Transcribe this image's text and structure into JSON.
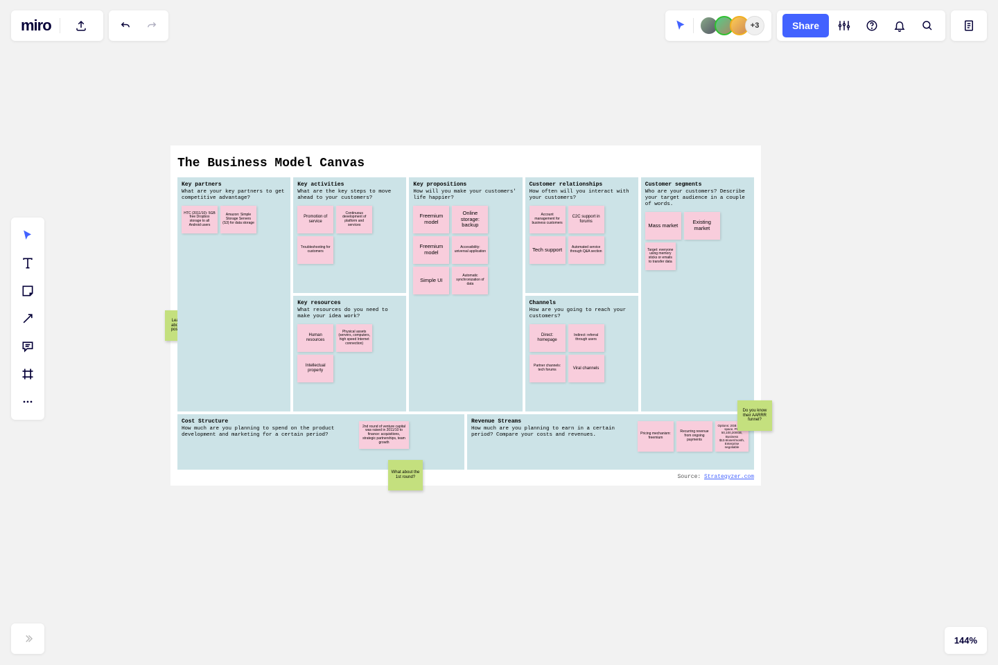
{
  "topbar": {
    "logo": "miro",
    "share": "Share",
    "avatar_more": "+3"
  },
  "zoom": "144%",
  "board": {
    "title": "The Business Model Canvas",
    "source_prefix": "Source: ",
    "source_link": "Strategyzer.com"
  },
  "cells": {
    "partners": {
      "title": "Key partners",
      "prompt": "What are your key partners to get competitive advantage?"
    },
    "activities": {
      "title": "Key activities",
      "prompt": "What are the key steps to move ahead to your customers?"
    },
    "resources": {
      "title": "Key resources",
      "prompt": "What resources do you need to make your idea work?"
    },
    "propositions": {
      "title": "Key propositions",
      "prompt": "How will you make your customers' life happier?"
    },
    "relationships": {
      "title": "Customer relationships",
      "prompt": "How often will you interact with your customers?"
    },
    "channels": {
      "title": "Channels",
      "prompt": "How are you going to reach your customers?"
    },
    "segments": {
      "title": "Customer segments",
      "prompt": "Who are your customers? Describe your target audience in a couple of words."
    },
    "cost": {
      "title": "Cost Structure",
      "prompt": "How much are you planning to spend on the product development and marketing for a certain period?"
    },
    "revenue": {
      "title": "Revenue Streams",
      "prompt": "How much are you planning to earn in a certain period? Compare your costs and revenues."
    }
  },
  "stickies": {
    "partners": [
      "HTC (2011/10): 5GB free Dropbox storage to all Android users",
      "Amazon: Simple Storage Servers (S3) for data storage"
    ],
    "activities": [
      "Promotion of service",
      "Continuous development of platform and services",
      "Troubleshooting for customers"
    ],
    "resources": [
      "Human resources",
      "Physical assets (servers, computers, high speed Internet connection)",
      "Intellectual property"
    ],
    "propositions": [
      "Freemium model",
      "Online storage: backup",
      "Freemium model",
      "Accessibility: universal application",
      "Simple UI",
      "Automatic synchronization of data"
    ],
    "relationships": [
      "Account management for business customers",
      "C2C support in forums",
      "Tech support",
      "Automated service through Q&A section"
    ],
    "channels": [
      "Direct: homepage",
      "Indirect: referral through users",
      "Partner channels: tech forums",
      "Viral channels"
    ],
    "segments": [
      "Mass market",
      "Existing market",
      "Target: everyone using memory sticks or emails to transfer data"
    ],
    "cost": [
      "2nd round of venture capital was raised in 2011/10 to finance: acquisitions, strategic partnerships, team growth"
    ],
    "revenue": [
      "Pricing mechanism: freemium",
      "Recurring revenue from ongoing payments",
      "Options: 2GB of free space, Pro 50,100,200GB, Business $13.6/user/month, Enterprise negotiable"
    ],
    "green_left": "Learn more about future possibilities!",
    "green_cost": "What about the 1st round?",
    "green_right": "Do you know their AARRR funnel?"
  }
}
